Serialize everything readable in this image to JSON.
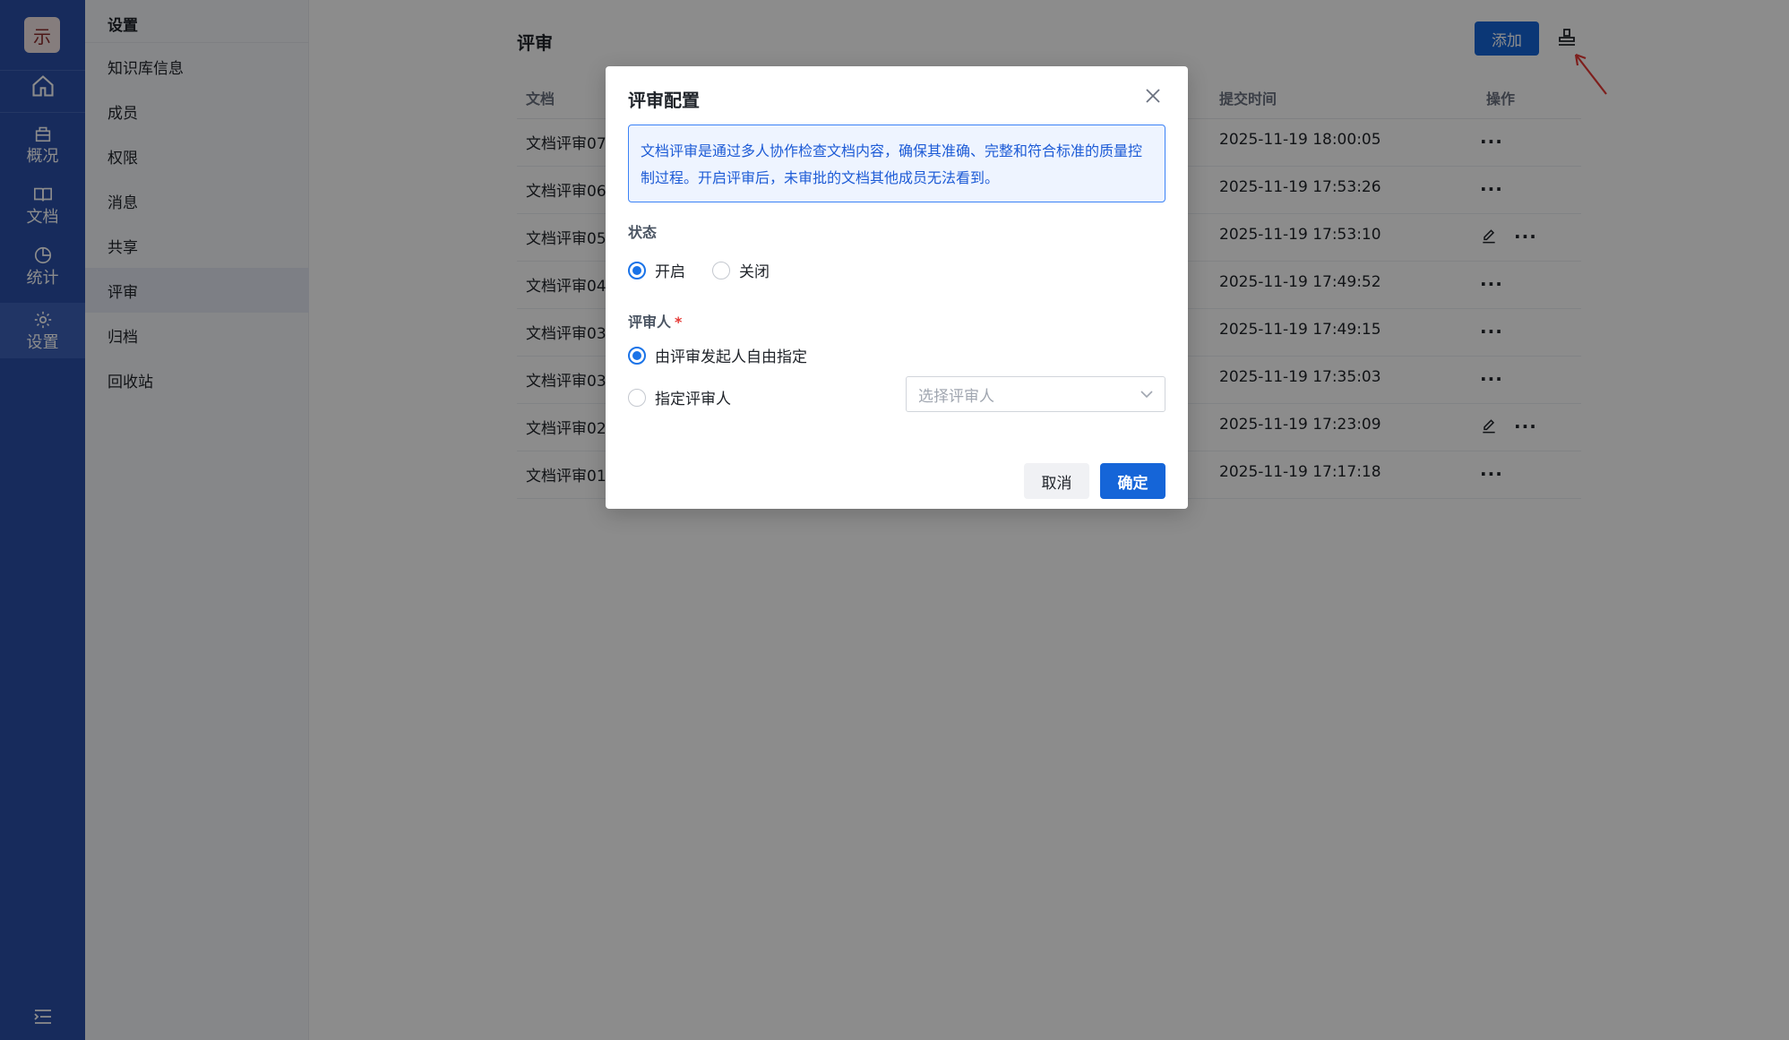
{
  "rail": {
    "logo_char": "示",
    "items": [
      {
        "icon": "home-icon",
        "label": ""
      },
      {
        "icon": "overview-icon",
        "label": "概况"
      },
      {
        "icon": "book-icon",
        "label": "文档"
      },
      {
        "icon": "pie-chart-icon",
        "label": "统计"
      },
      {
        "icon": "gear-icon",
        "label": "设置"
      }
    ],
    "bottom_icon": "menu-collapse-icon"
  },
  "subnav": {
    "title": "设置",
    "items": [
      "知识库信息",
      "成员",
      "权限",
      "消息",
      "共享",
      "评审",
      "归档",
      "回收站"
    ],
    "active": "评审"
  },
  "main": {
    "title": "评审",
    "add_label": "添加",
    "columns": {
      "doc": "文档",
      "time": "提交时间",
      "ops": "操作"
    },
    "rows": [
      {
        "doc": "文档评审07",
        "time": "2025-11-19 18:00:05",
        "editable": false
      },
      {
        "doc": "文档评审06",
        "time": "2025-11-19 17:53:26",
        "editable": false
      },
      {
        "doc": "文档评审05",
        "time": "2025-11-19 17:53:10",
        "editable": true
      },
      {
        "doc": "文档评审04",
        "time": "2025-11-19 17:49:52",
        "editable": false
      },
      {
        "doc": "文档评审03",
        "time": "2025-11-19 17:49:15",
        "editable": false
      },
      {
        "doc": "文档评审03",
        "time": "2025-11-19 17:35:03",
        "editable": false
      },
      {
        "doc": "文档评审02",
        "time": "2025-11-19 17:23:09",
        "editable": true
      },
      {
        "doc": "文档评审01",
        "time": "2025-11-19 17:17:18",
        "editable": false
      }
    ],
    "more_glyph": "···"
  },
  "modal": {
    "title": "评审配置",
    "info_text": "文档评审是通过多人协作检查文档内容，确保其准确、完整和符合标准的质量控制过程。开启评审后，未审批的文档其他成员无法看到。",
    "status_label": "状态",
    "status_on": "开启",
    "status_off": "关闭",
    "reviewer_label": "评审人",
    "required_mark": "*",
    "reviewer_free": "由评审发起人自由指定",
    "reviewer_assign": "指定评审人",
    "select_placeholder": "选择评审人",
    "cancel_label": "取消",
    "ok_label": "确定"
  },
  "colors": {
    "primary": "#1565d8",
    "rail": "#2a4fa8",
    "info_bg": "#eef4ff",
    "annotation_arrow": "#e53935"
  }
}
